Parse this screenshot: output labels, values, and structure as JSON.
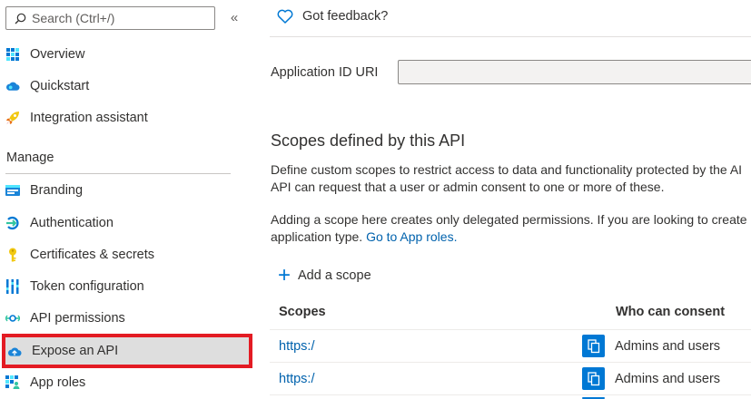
{
  "sidebar": {
    "search_placeholder": "Search (Ctrl+/)",
    "collapse_label": "«",
    "items_top": [
      {
        "label": "Overview",
        "icon": "overview-icon"
      },
      {
        "label": "Quickstart",
        "icon": "quickstart-cloud-icon"
      },
      {
        "label": "Integration assistant",
        "icon": "rocket-icon"
      }
    ],
    "section_manage": "Manage",
    "items_manage": [
      {
        "label": "Branding",
        "icon": "branding-icon"
      },
      {
        "label": "Authentication",
        "icon": "authentication-icon"
      },
      {
        "label": "Certificates & secrets",
        "icon": "key-icon"
      },
      {
        "label": "Token configuration",
        "icon": "token-bars-icon"
      },
      {
        "label": "API permissions",
        "icon": "api-permissions-icon"
      },
      {
        "label": "Expose an API",
        "icon": "expose-api-cloud-icon",
        "selected": true
      },
      {
        "label": "App roles",
        "icon": "app-roles-icon"
      }
    ]
  },
  "main": {
    "feedback": "Got feedback?",
    "app_id_label": "Application ID URI",
    "app_id_value": "",
    "scopes_title": "Scopes defined by this API",
    "desc1_line1": "Define custom scopes to restrict access to data and functionality protected by the AI",
    "desc1_line2": "API can request that a user or admin consent to one or more of these.",
    "desc2_line1": "Adding a scope here creates only delegated permissions. If you are looking to create",
    "desc2_line2_prefix": "application type. ",
    "desc2_link": "Go to App roles.",
    "add_scope": "Add a scope",
    "table": {
      "columns": [
        "Scopes",
        "Who can consent"
      ],
      "rows": [
        {
          "scope": "https:/",
          "consent": "Admins and users"
        },
        {
          "scope": "https:/",
          "consent": "Admins and users"
        }
      ]
    }
  },
  "colors": {
    "accent": "#0078d4",
    "link": "#0062ad",
    "selected_bg": "#dedede",
    "highlight_border": "#e31b23"
  }
}
